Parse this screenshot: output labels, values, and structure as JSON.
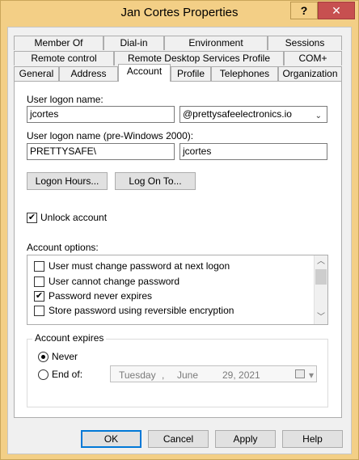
{
  "window": {
    "title": "Jan Cortes Properties",
    "help_glyph": "?",
    "close_glyph": "✕"
  },
  "tabs": {
    "row1": [
      "Member Of",
      "Dial-in",
      "Environment",
      "Sessions"
    ],
    "row2": [
      "Remote control",
      "Remote Desktop Services Profile",
      "COM+"
    ],
    "row3": [
      "General",
      "Address",
      "Account",
      "Profile",
      "Telephones",
      "Organization"
    ],
    "active": "Account"
  },
  "account": {
    "logon_name_label": "User logon name:",
    "logon_name_value": "jcortes",
    "upn_suffix_value": "@prettysafeelectronics.io",
    "pre2000_label": "User logon name (pre-Windows 2000):",
    "pre2000_domain_value": "PRETTYSAFE\\",
    "pre2000_user_value": "jcortes",
    "logon_hours_button": "Logon Hours...",
    "log_on_to_button": "Log On To...",
    "unlock_label": "Unlock account",
    "options_label": "Account options:",
    "options": [
      {
        "label": "User must change password at next logon",
        "checked": false
      },
      {
        "label": "User cannot change password",
        "checked": false
      },
      {
        "label": "Password never expires",
        "checked": true
      },
      {
        "label": "Store password using reversible encryption",
        "checked": false
      }
    ],
    "expires_label": "Account expires",
    "never_label": "Never",
    "end_of_label": "End of:",
    "end_date": {
      "weekday": "Tuesday",
      "sep1": ",",
      "month": "June",
      "day_year": "29, 2021"
    }
  },
  "buttons": {
    "ok": "OK",
    "cancel": "Cancel",
    "apply": "Apply",
    "help": "Help"
  },
  "icons": {
    "check": "✔",
    "arrow_down": "⌄",
    "scroll_up": "︿",
    "scroll_down": "﹀",
    "drop": "▾"
  }
}
